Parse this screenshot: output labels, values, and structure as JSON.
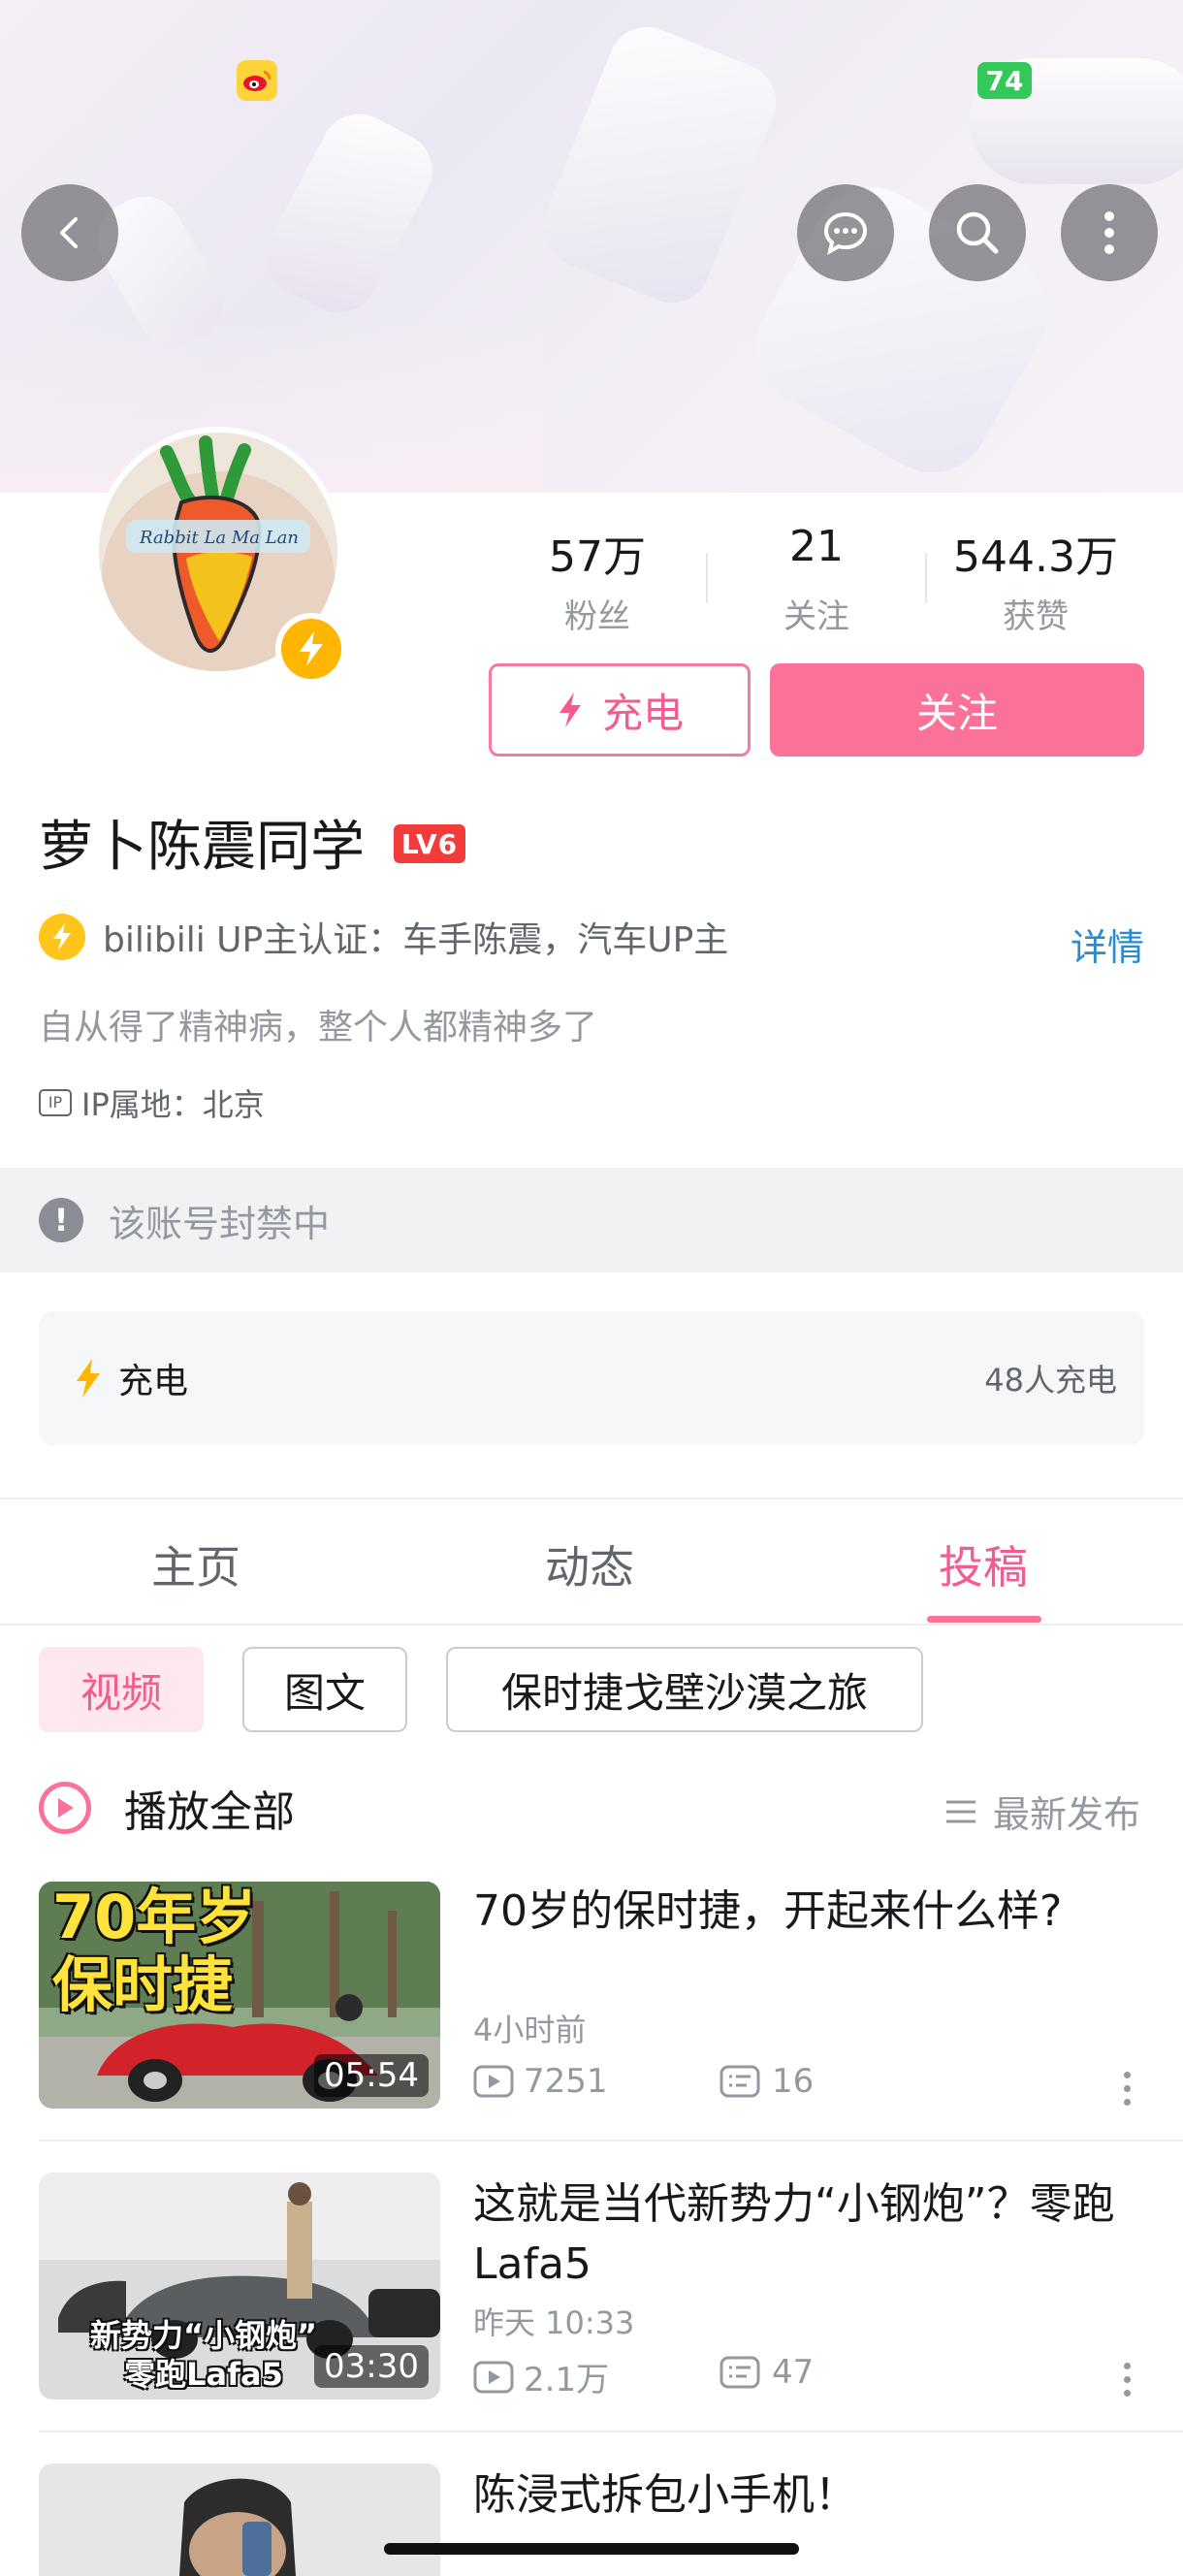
{
  "status": {
    "battery": "74"
  },
  "profile": {
    "name": "萝卜陈震同学",
    "level": "LV6",
    "stats": [
      {
        "value": "57万",
        "label": "粉丝"
      },
      {
        "value": "21",
        "label": "关注"
      },
      {
        "value": "544.3万",
        "label": "获赞"
      }
    ],
    "charge_button": "充电",
    "follow_button": "关注",
    "verify_text": "bilibili UP主认证：车手陈震，汽车UP主",
    "detail_link": "详情",
    "signature": "自从得了精神病，整个人都精神多了",
    "ip_icon_text": "IP",
    "ip_location": "IP属地：北京",
    "avatar_text": "Rabbit La Ma Lan"
  },
  "ban_notice": "该账号封禁中",
  "charge_card": {
    "label": "充电",
    "count": "48人充电"
  },
  "tabs": [
    {
      "label": "主页",
      "active": false
    },
    {
      "label": "动态",
      "active": false
    },
    {
      "label": "投稿",
      "active": true
    }
  ],
  "chips": [
    {
      "label": "视频",
      "active": true
    },
    {
      "label": "图文",
      "active": false
    },
    {
      "label": "保时捷戈壁沙漠之旅",
      "active": false
    }
  ],
  "play_all": "播放全部",
  "sort_label": "最新发布",
  "videos": [
    {
      "title": "70岁的保时捷，开起来什么样?",
      "time": "4小时前",
      "views": "7251",
      "danmaku": "16",
      "duration": "05:54",
      "thumb_text": [
        "70年岁",
        "保时捷"
      ]
    },
    {
      "title": "这就是当代新势力“小钢炮”？零跑Lafa5",
      "time": "昨天 10:33",
      "views": "2.1万",
      "danmaku": "47",
      "duration": "03:30",
      "thumb_text": [
        "新势力“小钢炮”",
        "零跑Lafa5"
      ]
    },
    {
      "title": "陈浸式拆包小手机！"
    }
  ],
  "colors": {
    "accent": "#fb7299",
    "link": "#2a8bcf",
    "charge": "#ffb600"
  }
}
